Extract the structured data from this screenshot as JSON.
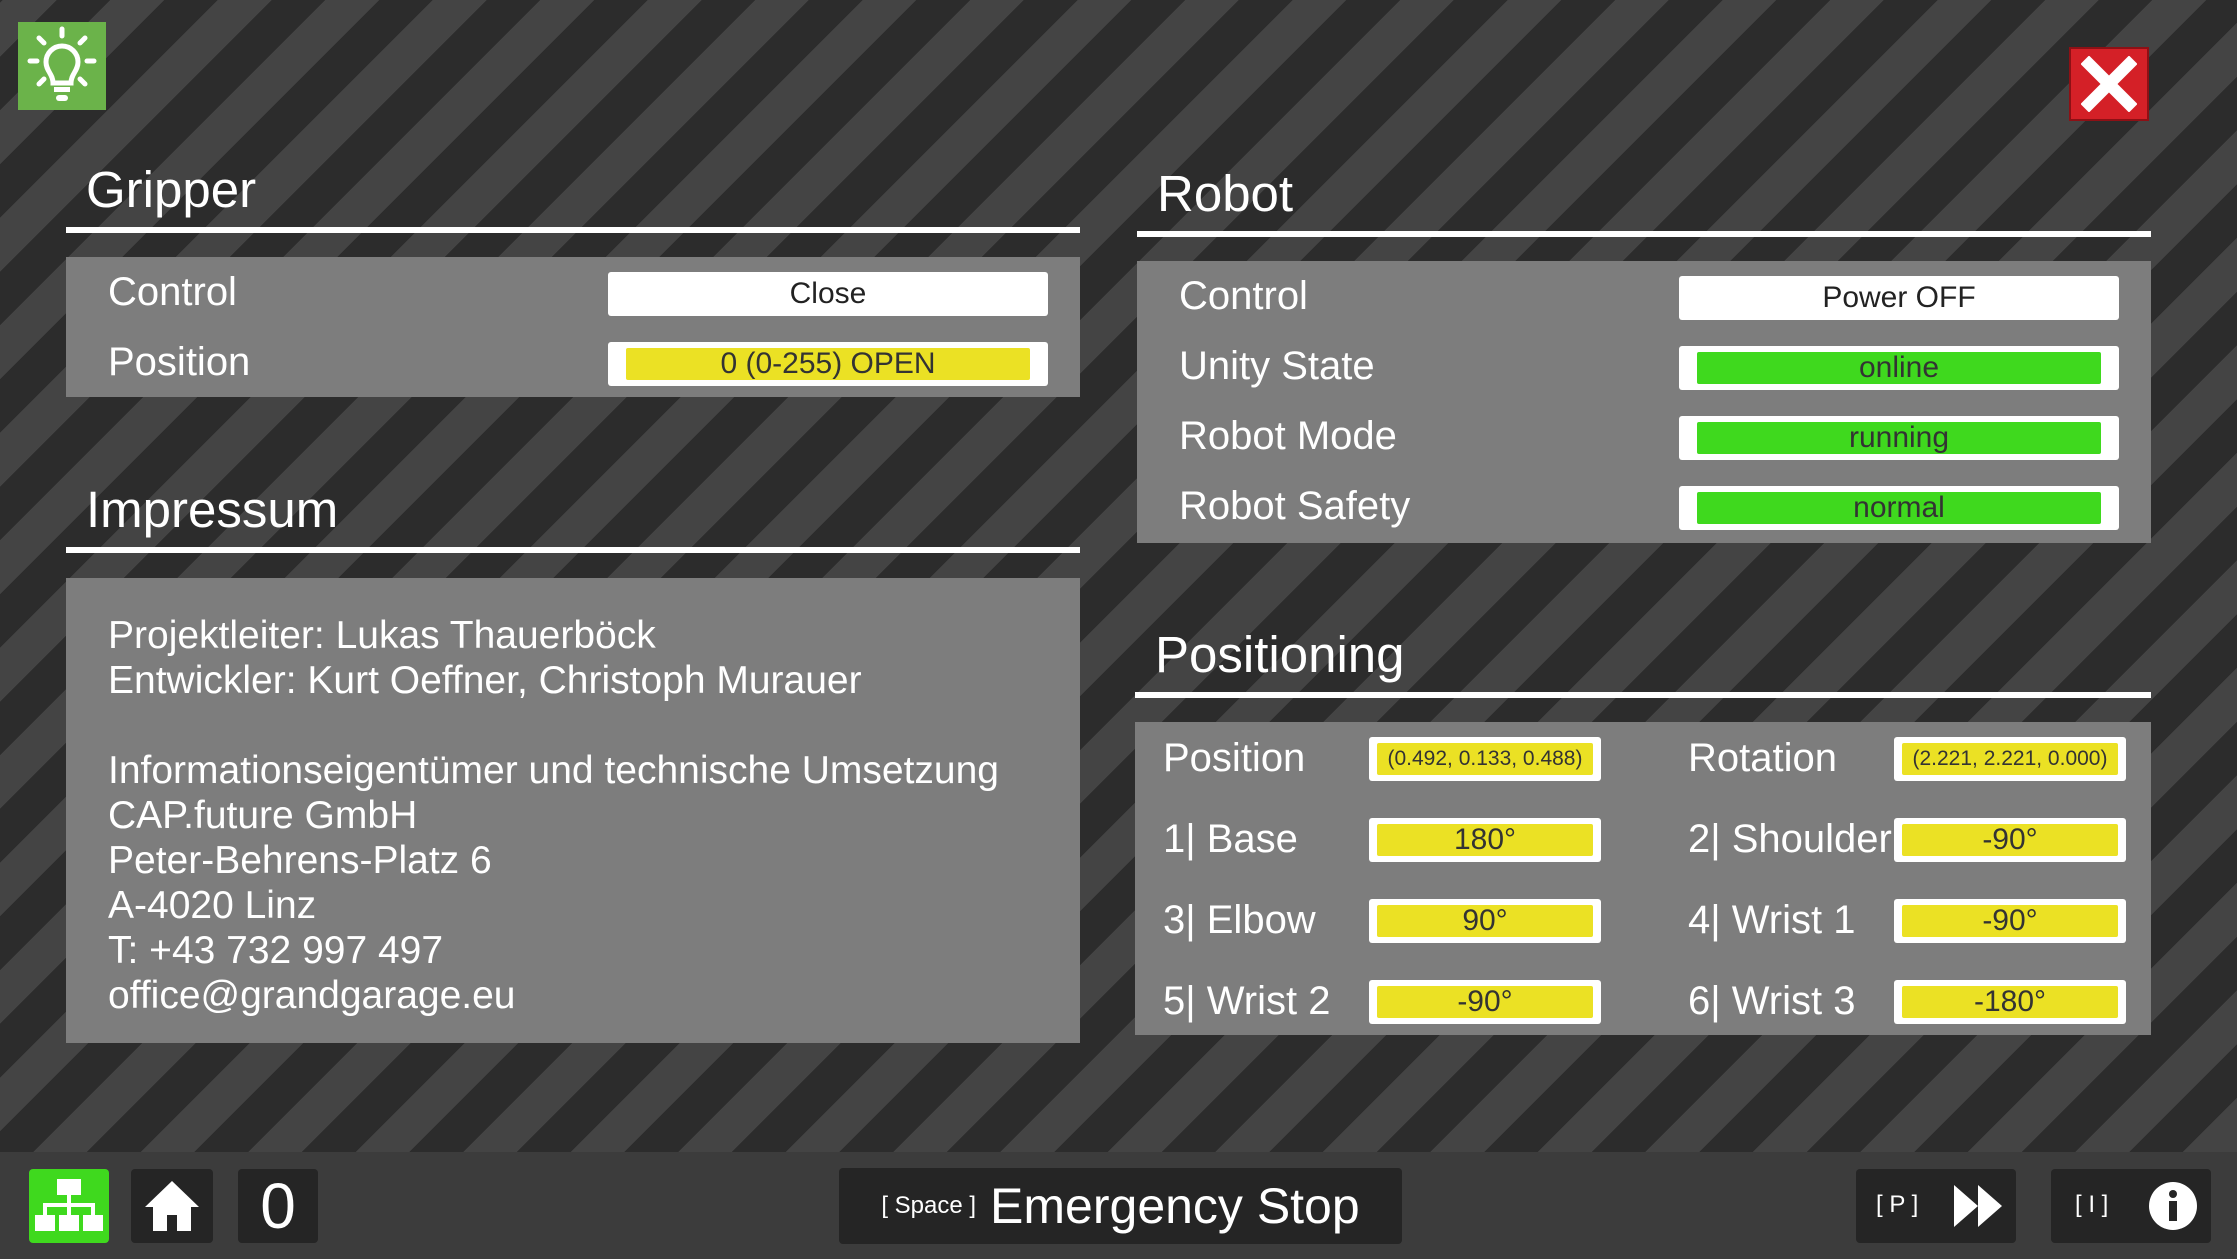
{
  "top": {
    "hint_icon": "lightbulb-icon",
    "close_icon": "close-x-icon"
  },
  "gripper": {
    "title": "Gripper",
    "control_label": "Control",
    "control_value": "Close",
    "position_label": "Position",
    "position_value": "0 (0-255) OPEN"
  },
  "robot": {
    "title": "Robot",
    "control_label": "Control",
    "control_value": "Power OFF",
    "unity_state_label": "Unity State",
    "unity_state_value": "online",
    "robot_mode_label": "Robot Mode",
    "robot_mode_value": "running",
    "robot_safety_label": "Robot Safety",
    "robot_safety_value": "normal"
  },
  "impressum": {
    "title": "Impressum",
    "lines": [
      "Projektleiter: Lukas Thauerböck",
      "Entwickler: Kurt Oeffner, Christoph Murauer",
      "",
      "Informationseigentümer und technische Umsetzung",
      "CAP.future GmbH",
      "Peter-Behrens-Platz 6",
      "A-4020 Linz",
      "T: +43 732 997 497",
      "office@grandgarage.eu"
    ]
  },
  "positioning": {
    "title": "Positioning",
    "position_label": "Position",
    "position_value": "(0.492, 0.133, 0.488)",
    "rotation_label": "Rotation",
    "rotation_value": "(2.221, 2.221, 0.000)",
    "joints": [
      {
        "label": "1| Base",
        "value": "180°"
      },
      {
        "label": "2| Shoulder",
        "value": "-90°"
      },
      {
        "label": "3| Elbow",
        "value": "90°"
      },
      {
        "label": "4| Wrist 1",
        "value": "-90°"
      },
      {
        "label": "5| Wrist 2",
        "value": "-90°"
      },
      {
        "label": "6| Wrist 3",
        "value": "-180°"
      }
    ]
  },
  "bottom": {
    "counter": "0",
    "emergency_key": "[ Space ]",
    "emergency_label": "Emergency Stop",
    "play_key": "[ P ]",
    "info_key": "[ I ]",
    "colors": {
      "green": "#3fd91e",
      "yellow": "#ebe124",
      "red": "#d42027"
    }
  }
}
